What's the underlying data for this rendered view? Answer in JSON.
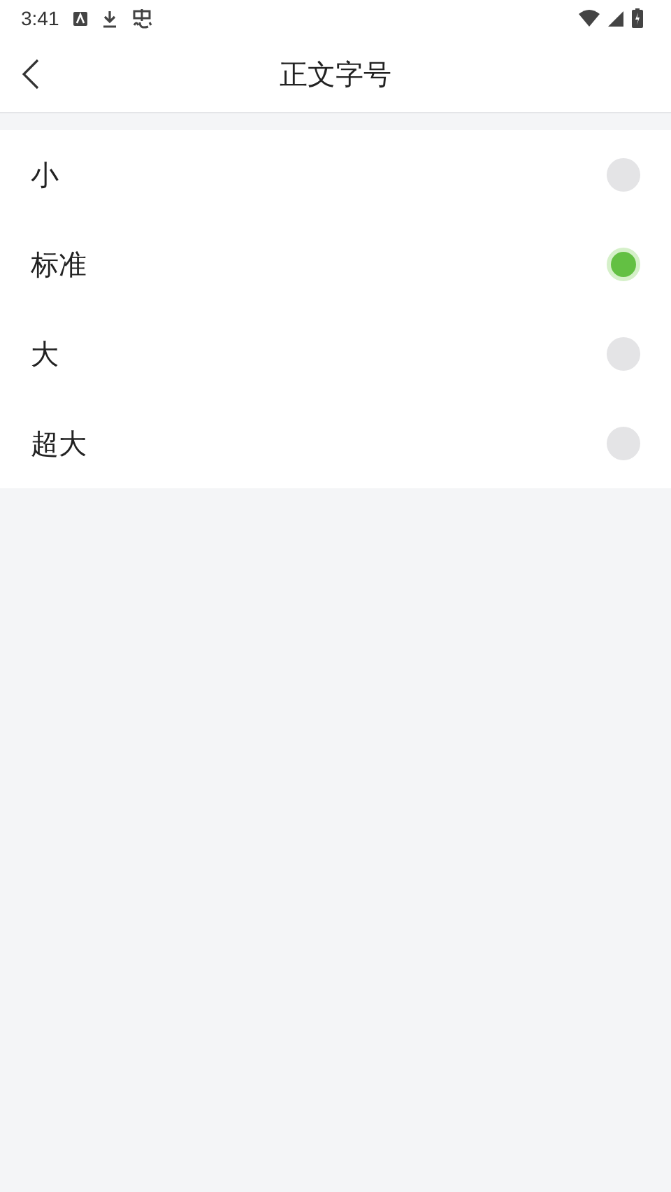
{
  "status_bar": {
    "time": "3:41"
  },
  "header": {
    "title": "正文字号"
  },
  "options": [
    {
      "label": "小",
      "selected": false
    },
    {
      "label": "标准",
      "selected": true
    },
    {
      "label": "大",
      "selected": false
    },
    {
      "label": "超大",
      "selected": false
    }
  ]
}
